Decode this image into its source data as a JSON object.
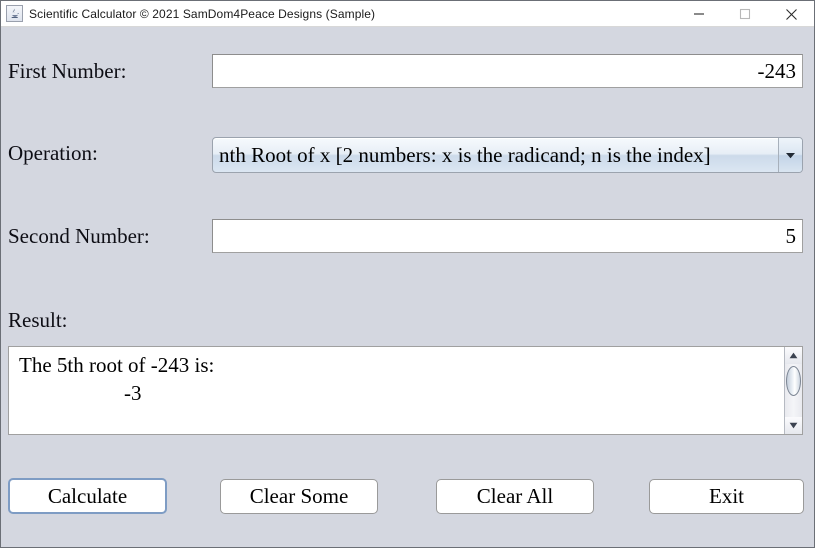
{
  "window": {
    "title": "Scientific Calculator © 2021 SamDom4Peace Designs (Sample)",
    "icon": "java-coffee-cup-icon",
    "bg_color": "#d4d7e0",
    "controls": {
      "minimize": "minimize-icon",
      "maximize": "maximize-icon",
      "close": "close-icon"
    }
  },
  "form": {
    "first_number": {
      "label": "First Number:",
      "value": "-243",
      "placeholder": ""
    },
    "operation": {
      "label": "Operation:",
      "selected": "nth Root of x [2 numbers: x is the radicand; n is the index]",
      "arrow_icon": "chevron-down-icon"
    },
    "second_number": {
      "label": "Second Number:",
      "value": "5",
      "placeholder": ""
    },
    "result": {
      "label": "Result:",
      "text": "The 5th root of -243 is:\n                    -3"
    }
  },
  "scrollbar": {
    "up_icon": "scroll-up-arrow-icon",
    "down_icon": "scroll-down-arrow-icon"
  },
  "buttons": {
    "calculate": "Calculate",
    "clear_some": "Clear Some",
    "clear_all": "Clear All",
    "exit": "Exit"
  }
}
